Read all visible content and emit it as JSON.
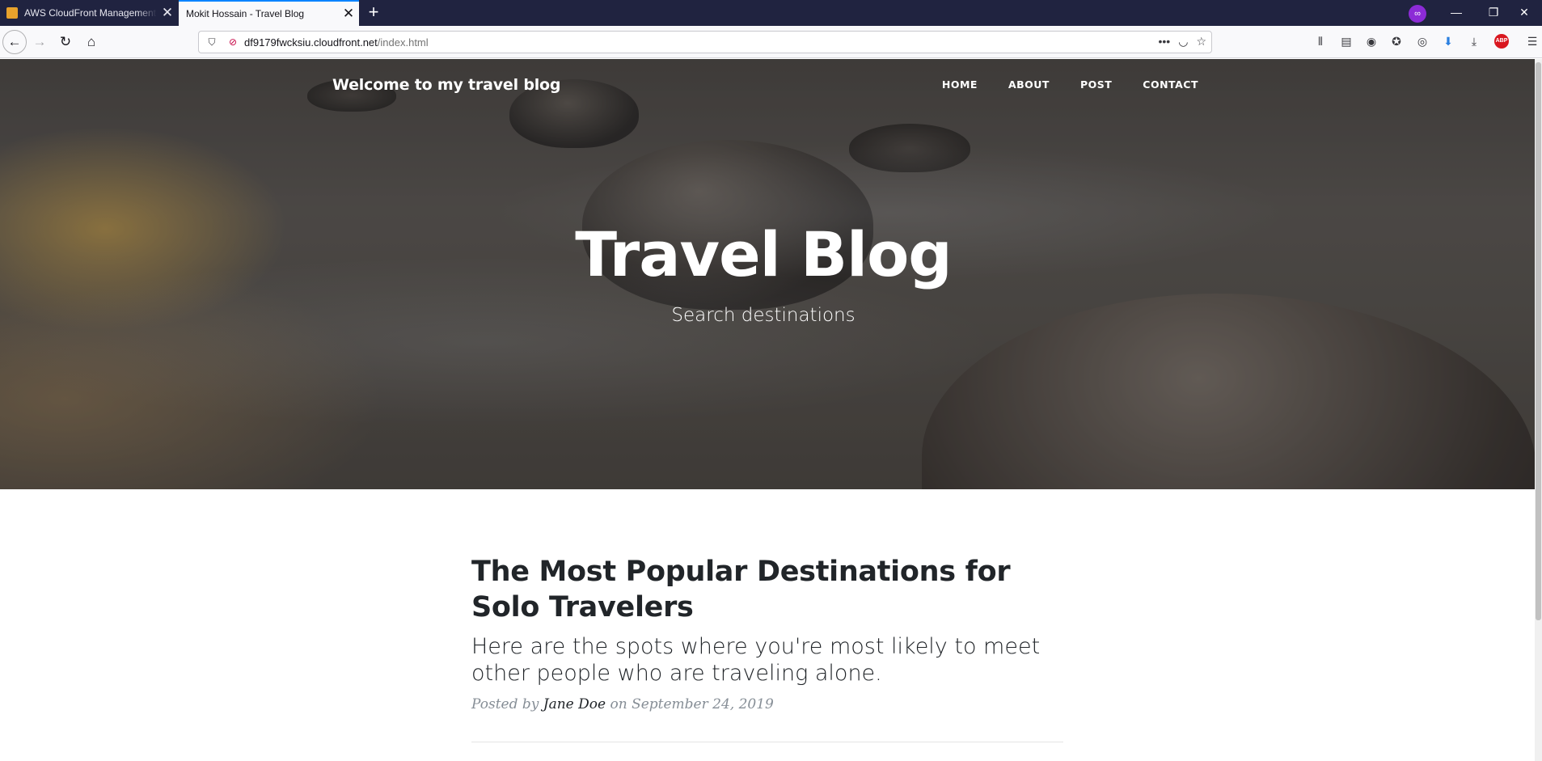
{
  "browser": {
    "tabs": [
      {
        "title": "AWS CloudFront Management Console",
        "active": false
      },
      {
        "title": "Mokit Hossain - Travel Blog",
        "active": true
      }
    ],
    "new_tab_symbol": "+",
    "url": {
      "host": "df9179fwcksiu.cloudfront.net",
      "path": "/index.html"
    },
    "window_controls": {
      "minimize": "—",
      "restore": "❐",
      "close": "✕"
    },
    "icons": [
      "back-icon",
      "forward-icon",
      "reload-icon",
      "home-icon",
      "shield-icon",
      "insecure-lock-icon",
      "more-icon",
      "pocket-icon",
      "bookmark-star-icon",
      "library-icon",
      "sidebar-icon",
      "account-icon",
      "extension-icon",
      "globe-icon",
      "download-arrow-icon",
      "downloads-icon",
      "adblock-plus-icon",
      "menu-icon"
    ],
    "abp_label": "ABP",
    "accent": "#0a84ff"
  },
  "site": {
    "brand": "Welcome to my travel blog",
    "nav": [
      "HOME",
      "ABOUT",
      "POST",
      "CONTACT"
    ],
    "hero": {
      "title": "Travel Blog",
      "subtitle": "Search destinations"
    }
  },
  "posts": [
    {
      "title": "The Most Popular Destinations for Solo Travelers",
      "subtitle": "Here are the spots where you're most likely to meet other people who are traveling alone.",
      "meta_prefix": "Posted by",
      "author": "Jane Doe",
      "meta_date": "on September 24, 2019"
    }
  ]
}
